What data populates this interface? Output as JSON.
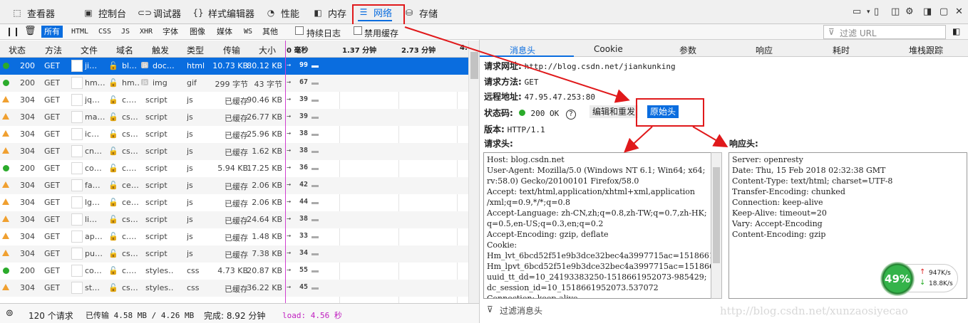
{
  "toolbar": {
    "tabs": [
      {
        "label": "查看器",
        "icon": "inspector-icon"
      },
      {
        "label": "控制台",
        "icon": "console-icon"
      },
      {
        "label": "调试器",
        "icon": "debugger-icon"
      },
      {
        "label": "样式编辑器",
        "icon": "braces-icon"
      },
      {
        "label": "性能",
        "icon": "performance-icon"
      },
      {
        "label": "内存",
        "icon": "memory-icon"
      },
      {
        "label": "网络",
        "icon": "network-icon"
      },
      {
        "label": "存储",
        "icon": "storage-icon"
      }
    ]
  },
  "filters": {
    "types": [
      "所有",
      "HTML",
      "CSS",
      "JS",
      "XHR",
      "字体",
      "图像",
      "媒体",
      "WS",
      "其他"
    ],
    "persist_logs": "持续日志",
    "disable_cache": "禁用缓存",
    "url_placeholder": "过滤 URL"
  },
  "table": {
    "columns": [
      "状态",
      "方法",
      "文件",
      "域名",
      "触发",
      "类型",
      "传输",
      "大小"
    ],
    "timeline_ticks": [
      "0 毫秒",
      "1.37 分钟",
      "2.73 分钟",
      "4."
    ],
    "rows": [
      {
        "status": "200",
        "kind": "ok",
        "method": "GET",
        "file": "ji…",
        "domain": "bl…",
        "cause": "doc…",
        "type": "html",
        "transferred": "10.73 KB",
        "size": "80.12 KB",
        "time": "99",
        "selected": true
      },
      {
        "status": "200",
        "kind": "ok",
        "method": "GET",
        "file": "hm…",
        "domain": "hm…",
        "cause": "img",
        "type": "gif",
        "transferred": "299 字节",
        "size": "43 字节",
        "time": "67"
      },
      {
        "status": "304",
        "kind": "warn",
        "method": "GET",
        "file": "jq…",
        "domain": "c.…",
        "cause": "script",
        "type": "js",
        "transferred": "已缓存",
        "size": "90.46 KB",
        "time": "39"
      },
      {
        "status": "304",
        "kind": "warn",
        "method": "GET",
        "file": "ma…",
        "domain": "cs…",
        "cause": "script",
        "type": "js",
        "transferred": "已缓存",
        "size": "26.77 KB",
        "time": "39"
      },
      {
        "status": "304",
        "kind": "warn",
        "method": "GET",
        "file": "ic…",
        "domain": "cs…",
        "cause": "script",
        "type": "js",
        "transferred": "已缓存",
        "size": "25.96 KB",
        "time": "38"
      },
      {
        "status": "304",
        "kind": "warn",
        "method": "GET",
        "file": "cn…",
        "domain": "cs…",
        "cause": "script",
        "type": "js",
        "transferred": "已缓存",
        "size": "1.62 KB",
        "time": "38"
      },
      {
        "status": "200",
        "kind": "ok",
        "method": "GET",
        "file": "co…",
        "domain": "c.…",
        "cause": "script",
        "type": "js",
        "transferred": "5.94 KB",
        "size": "17.25 KB",
        "time": "36"
      },
      {
        "status": "304",
        "kind": "warn",
        "method": "GET",
        "file": "fa…",
        "domain": "ce…",
        "cause": "script",
        "type": "js",
        "transferred": "已缓存",
        "size": "2.06 KB",
        "time": "42"
      },
      {
        "status": "304",
        "kind": "warn",
        "method": "GET",
        "file": "lg…",
        "domain": "ce…",
        "cause": "script",
        "type": "js",
        "transferred": "已缓存",
        "size": "2.06 KB",
        "time": "44"
      },
      {
        "status": "304",
        "kind": "warn",
        "method": "GET",
        "file": "li…",
        "domain": "cs…",
        "cause": "script",
        "type": "js",
        "transferred": "已缓存",
        "size": "24.64 KB",
        "time": "38"
      },
      {
        "status": "304",
        "kind": "warn",
        "method": "GET",
        "file": "ap…",
        "domain": "c.…",
        "cause": "script",
        "type": "js",
        "transferred": "已缓存",
        "size": "1.48 KB",
        "time": "33"
      },
      {
        "status": "304",
        "kind": "warn",
        "method": "GET",
        "file": "pu…",
        "domain": "cs…",
        "cause": "script",
        "type": "js",
        "transferred": "已缓存",
        "size": "7.38 KB",
        "time": "34"
      },
      {
        "status": "200",
        "kind": "ok",
        "method": "GET",
        "file": "co…",
        "domain": "c.…",
        "cause": "styles…",
        "type": "css",
        "transferred": "4.73 KB",
        "size": "20.87 KB",
        "time": "55"
      },
      {
        "status": "304",
        "kind": "warn",
        "method": "GET",
        "file": "st…",
        "domain": "cs…",
        "cause": "styles…",
        "type": "css",
        "transferred": "已缓存",
        "size": "36.22 KB",
        "time": "45"
      }
    ]
  },
  "statusbar": {
    "requests": "120 个请求",
    "transferred": "已传输 4.58 MB / 4.26 MB",
    "finish": "完成: 8.92 分钟",
    "load": "load: 4.56 秒"
  },
  "detail": {
    "tabs": [
      "消息头",
      "Cookie",
      "参数",
      "响应",
      "耗时",
      "堆栈跟踪"
    ],
    "request_url_label": "请求网址:",
    "request_url": "http://blog.csdn.net/jiankunking",
    "method_label": "请求方法:",
    "method": "GET",
    "remote_label": "远程地址:",
    "remote": "47.95.47.253:80",
    "status_label": "状态码:",
    "status": "200 OK",
    "edit_resend": "编辑和重发",
    "raw_headers": "原始头",
    "version_label": "版本:",
    "version": "HTTP/1.1",
    "req_headers_label": "请求头:",
    "resp_headers_label": "响应头:",
    "request_headers": "Host: blog.csdn.net\nUser-Agent: Mozilla/5.0 (Windows NT 6.1; Win64; x64;\nrv:58.0) Gecko/20100101 Firefox/58.0\nAccept: text/html,application/xhtml+xml,application\n/xml;q=0.9,*/*;q=0.8\nAccept-Language: zh-CN,zh;q=0.8,zh-TW;q=0.7,zh-HK;\nq=0.5,en-US;q=0.3,en;q=0.2\nAccept-Encoding: gzip, deflate\nCookie:\nHm_lvt_6bcd52f51e9b3dce32bec4a3997715ac=1518661950;\nHm_lpvt_6bcd52f51e9b3dce32bec4a3997715ac=1518661950;\nuuid_tt_dd=10_24193383250-1518661952073-985429;\ndc_session_id=10_1518661952073.537072\nConnection: keep-alive",
    "response_headers": "Server: openresty\nDate: Thu, 15 Feb 2018 02:32:38 GMT\nContent-Type: text/html; charset=UTF-8\nTransfer-Encoding: chunked\nConnection: keep-alive\nKeep-Alive: timeout=20\nVary: Accept-Encoding\nContent-Encoding: gzip",
    "msg_filter": "过滤消息头"
  },
  "overlay": {
    "percent": "49%",
    "up": "947K/s",
    "down": "18.8K/s",
    "watermark": "http://blog.csdn.net/xunzaosiyecao"
  }
}
